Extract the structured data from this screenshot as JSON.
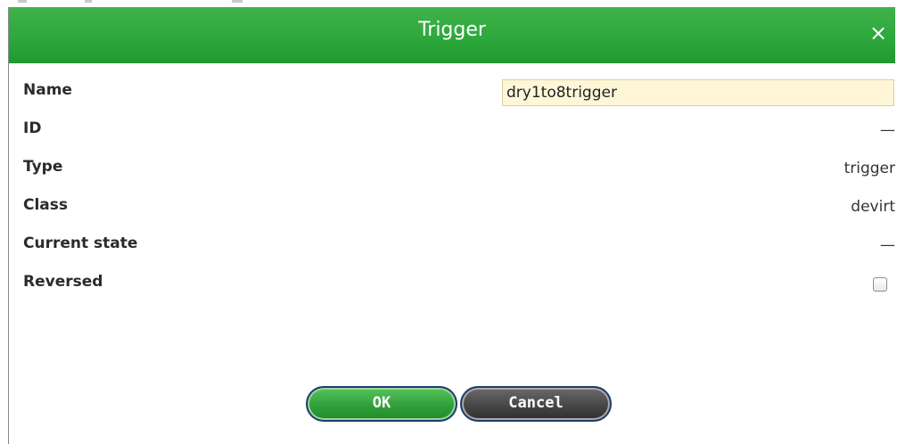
{
  "dialog": {
    "title": "Trigger",
    "close_glyph": "×",
    "close_icon": "close-icon"
  },
  "fields": {
    "name": {
      "label": "Name",
      "value": "dry1to8trigger"
    },
    "id": {
      "label": "ID",
      "value": "—"
    },
    "type": {
      "label": "Type",
      "value": "trigger"
    },
    "class": {
      "label": "Class",
      "value": "devirt"
    },
    "current_state": {
      "label": "Current state",
      "value": "—"
    },
    "reversed": {
      "label": "Reversed",
      "checked": false
    }
  },
  "buttons": {
    "ok": "OK",
    "cancel": "Cancel"
  },
  "colors": {
    "title_green": "#2ea83c",
    "ok_green": "#2f9e38",
    "cancel_gray": "#444444",
    "input_bg": "#fff6d8"
  }
}
